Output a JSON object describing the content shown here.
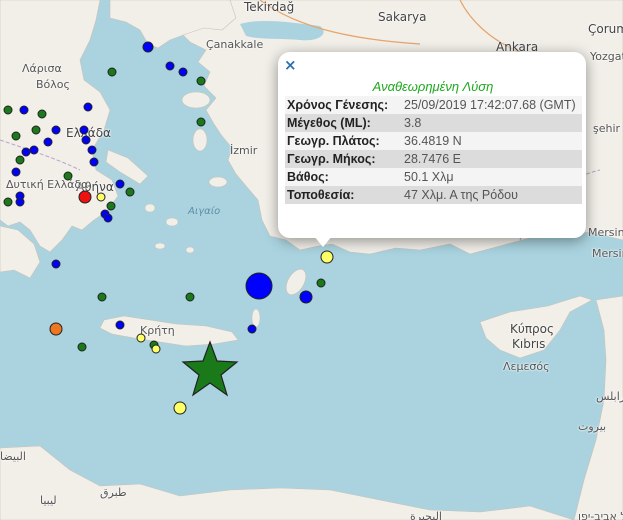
{
  "popup": {
    "close_label": "×",
    "title": "Αναθεωρημένη Λύση",
    "rows": [
      {
        "key": "Χρόνος Γένεσης:",
        "value": "25/09/2019 17:42:07.68 (GMT)"
      },
      {
        "key": "Μέγεθος (ML):",
        "value": "3.8"
      },
      {
        "key": "Γεωγρ. Πλάτος:",
        "value": "36.4819 N"
      },
      {
        "key": "Γεωγρ. Μήκος:",
        "value": "28.7476 E"
      },
      {
        "key": "Βάθος:",
        "value": "50.1 Χλμ"
      },
      {
        "key": "Τοποθεσία:",
        "value": "47 Χλμ. Α της Ρόδου"
      }
    ]
  },
  "places": {
    "tekirdag": "Tekirdağ",
    "sakarya": "Sakarya",
    "corum": "Çorum",
    "canakkale": "Çanakkale",
    "ankara": "Ankara",
    "yozgat": "Yozgat",
    "larisa": "Λάρισα",
    "volos": "Βόλος",
    "ellada": "Ελλάδα",
    "athina": "Αθήνα",
    "dytiki": "Δυτική Ελλάδα",
    "izmir": "İzmir",
    "aigaio": "Αιγαίο",
    "kriti": "Κρήτη",
    "kypros": "Κύπρος",
    "kibris": "Kıbrıs",
    "lemesos": "Λεμεσός",
    "mersin1": "Mersin",
    "mersin2": "Mersin",
    "sehir": "şehir",
    "arabic_top": "البحيرة",
    "arabic_tarabulus": "طرابلس",
    "telaviv": "תל אביב-יפו",
    "arabic_left": "البيضا",
    "arabic_mid": "طبرق",
    "arabic_libya": "ليبيا",
    "arabic_right": "بيروت",
    "dots": "ر"
  },
  "colors": {
    "sea": "#aad3df",
    "land": "#f2efe9",
    "blue": "#0000ff",
    "green": "#1a7a1a",
    "yellow": "#ffff66",
    "red": "#ee1111",
    "orange": "#ee7722",
    "star": "#1a7a1a",
    "title": "#1fa81f"
  },
  "markers_legend": [
    "blue-circle",
    "green-circle",
    "yellow-circle",
    "red-circle",
    "orange-circle",
    "green-star"
  ]
}
